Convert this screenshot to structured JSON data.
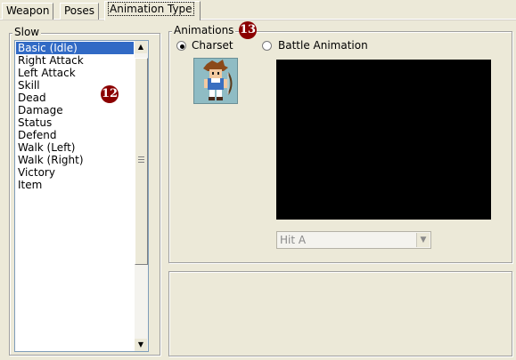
{
  "tabs": [
    {
      "label": "Weapon",
      "active": false
    },
    {
      "label": "Poses",
      "active": false
    },
    {
      "label": "Animation Type",
      "active": true
    }
  ],
  "left_group": {
    "legend": "Slow",
    "badge": "12",
    "items": [
      "Basic (Idle)",
      "Right Attack",
      "Left Attack",
      "Skill",
      "Dead",
      "Damage",
      "Status",
      "Defend",
      "Walk (Left)",
      "Walk (Right)",
      "Victory",
      "Item"
    ],
    "selected_index": 0
  },
  "animations_group": {
    "legend": "Animations",
    "badge": "13",
    "radio_charset": {
      "label": "Charset",
      "checked": true
    },
    "radio_battle": {
      "label": "Battle Animation",
      "checked": false
    },
    "combo_value": "Hit A",
    "colors": {
      "preview_bg": "#000000",
      "selection_bg": "#316ac5",
      "badge_bg": "#8b0000"
    }
  },
  "icons": {
    "scroll_up": "scroll-up-arrow",
    "scroll_down": "scroll-down-arrow",
    "charset_sprite": "character-sprite",
    "combo_arrow": "chevron-down"
  }
}
